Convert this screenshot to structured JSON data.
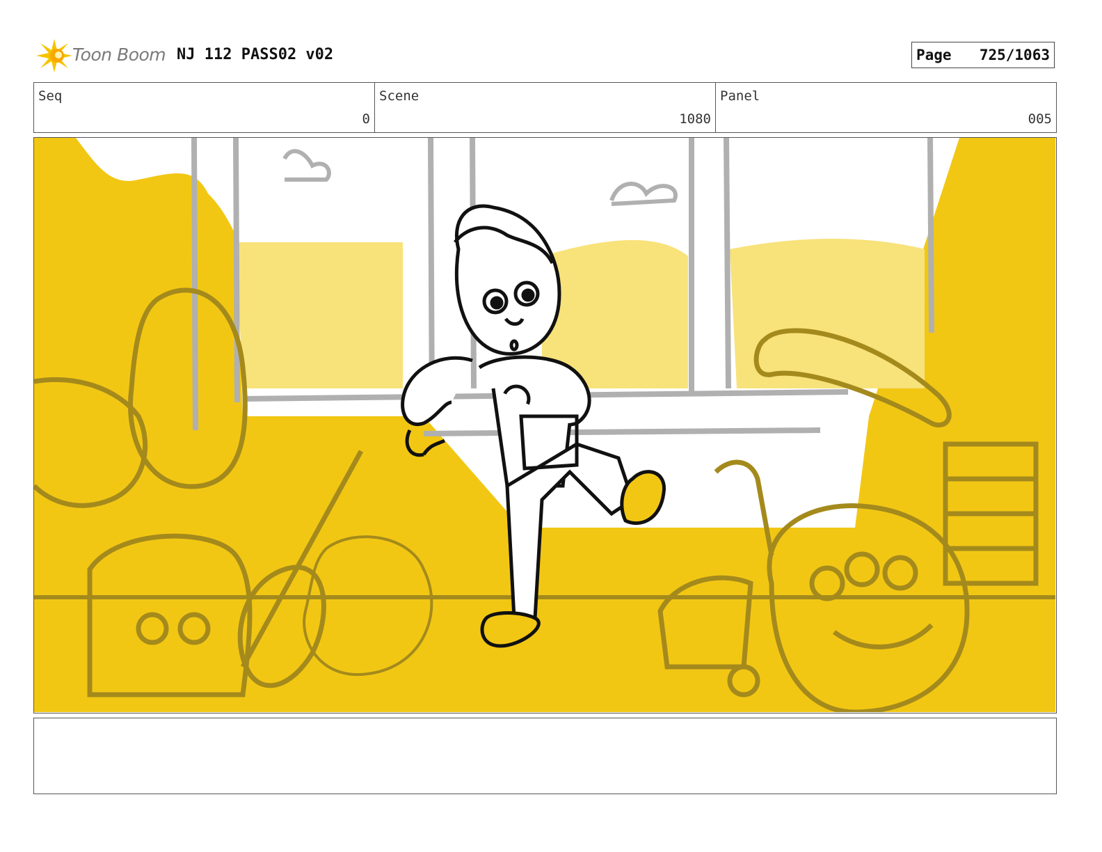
{
  "header": {
    "logo_text": "Toon Boom",
    "title": "NJ 112 PASS02 v02",
    "page_label": "Page",
    "page_number": "725/1063"
  },
  "info": {
    "seq_label": "Seq",
    "seq_value": "0",
    "scene_label": "Scene",
    "scene_value": "1080",
    "panel_label": "Panel",
    "panel_value": "005"
  },
  "colors": {
    "bg_yellow": "#f2c714",
    "light_yellow": "#f8e27a",
    "bg_line": "#a48a1c",
    "window_gray": "#b0b0b0",
    "ink": "#111111"
  },
  "notes": {
    "dialogue": ""
  }
}
